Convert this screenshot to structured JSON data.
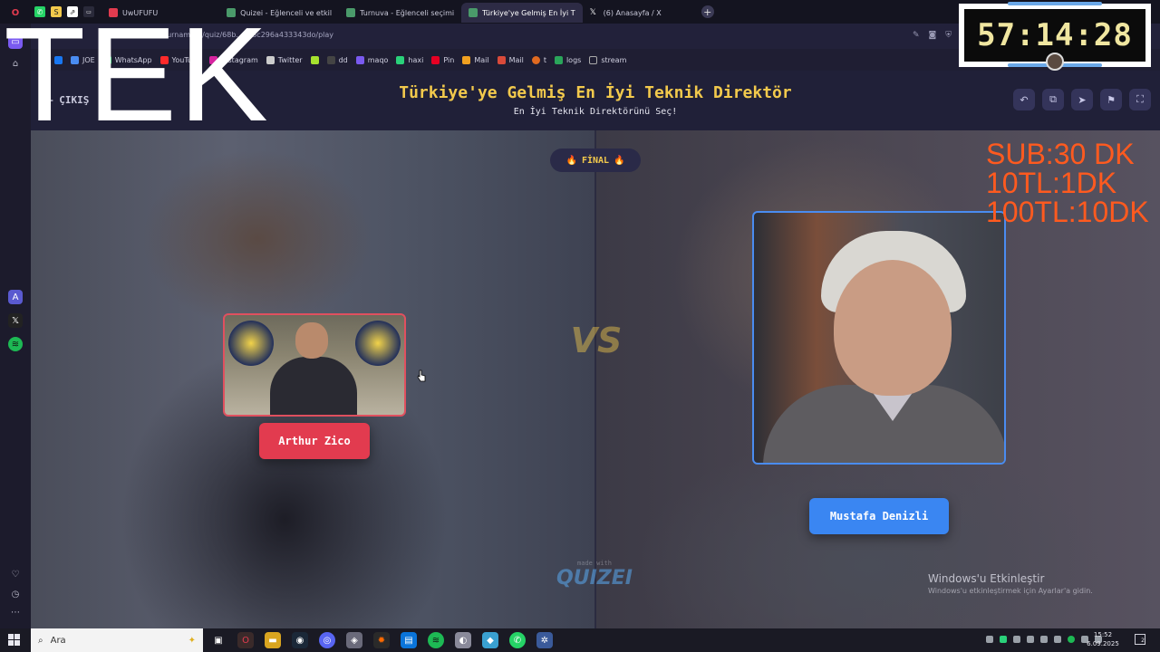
{
  "browser": {
    "tabs": [
      {
        "label": "UwUFUFU",
        "color": "#e23b4f"
      },
      {
        "label": "Quizei - Eğlenceli ve etkil",
        "color": "#3a3a5a"
      },
      {
        "label": "Turnuva - Eğlenceli seçimi",
        "color": "#3a3a5a"
      },
      {
        "label": "Türkiye'ye Gelmiş En İyi T",
        "color": "#3a3a5a",
        "active": true
      },
      {
        "label": "(6) Anasayfa / X",
        "color": "#ffffff"
      }
    ],
    "new_tab": "+",
    "url": "quizei.com/tournament/quiz/68b...368c296a433343do/play",
    "bookmarks": [
      {
        "label": "JOE",
        "color": "#4a8cf0"
      },
      {
        "label": "WhatsApp",
        "color": "#25d366"
      },
      {
        "label": "YouTube",
        "color": "#ff2a2a"
      },
      {
        "label": "Instagram",
        "color": "#d6249f"
      },
      {
        "label": "Twitter",
        "color": "#cccccc"
      },
      {
        "label": "dd",
        "color": "#444444"
      },
      {
        "label": "maqo",
        "color": "#7a5af0"
      },
      {
        "label": "haxi",
        "color": "#2ad17a"
      },
      {
        "label": "Pin",
        "color": "#e60023"
      },
      {
        "label": "Mail",
        "color": "#f0a020"
      },
      {
        "label": "Mail",
        "color": "#d94a3a"
      },
      {
        "label": "t",
        "color": "#e06a20"
      },
      {
        "label": "logs",
        "color": "#2aa55a"
      },
      {
        "label": "stream",
        "color": "#888888"
      }
    ]
  },
  "quiz": {
    "back_label": "ÇIKIŞ",
    "title": "Türkiye'ye Gelmiş En İyi Teknik Direktör",
    "subtitle": "En İyi Teknik Direktörünü Seç!",
    "round_label": "FİNAL",
    "vs_label": "VS",
    "left_choice": "Arthur Zico",
    "right_choice": "Mustafa Denizli",
    "made_with": "made with",
    "brand": "QUIZEI",
    "controls": [
      "undo-icon",
      "copy-icon",
      "send-icon",
      "flag-icon",
      "fullscreen-icon"
    ]
  },
  "windows_watermark": {
    "title": "Windows'u Etkinleştir",
    "subtitle": "Windows'u etkinleştirmek için Ayarlar'a gidin."
  },
  "overlay": {
    "tek": "TEK",
    "timer": "57:14:28",
    "donate_lines": [
      "SUB:30 DK",
      "10TL:1DK",
      "100TL:10DK"
    ],
    "accent": "#ff5a1f"
  },
  "taskbar": {
    "search_placeholder": "Ara",
    "time": "15:52",
    "date": "6.09.2025"
  }
}
